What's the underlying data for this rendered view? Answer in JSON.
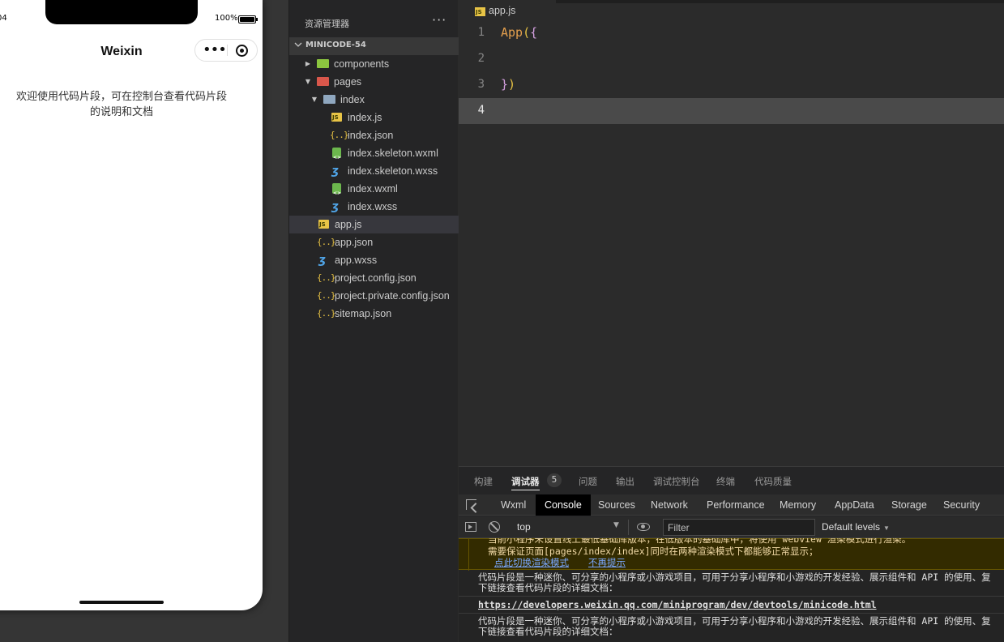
{
  "simulator": {
    "status_time": "04",
    "battery_text": "100%",
    "nav_title": "Weixin",
    "welcome_line1": "欢迎使用代码片段，可在控制台查看代码片段",
    "welcome_line2": "的说明和文档",
    "capsule_more_icon": "ellipsis-icon",
    "capsule_close_icon": "target-icon"
  },
  "explorer": {
    "title": "资源管理器",
    "more": "···",
    "project": "MINICODE-54",
    "items": [
      {
        "label": "components",
        "icon": "folder-green"
      },
      {
        "label": "pages",
        "icon": "folder-red"
      },
      {
        "label": "index",
        "icon": "folder-open"
      },
      {
        "label": "index.js",
        "icon": "js"
      },
      {
        "label": "index.json",
        "icon": "json"
      },
      {
        "label": "index.skeleton.wxml",
        "icon": "wxml"
      },
      {
        "label": "index.skeleton.wxss",
        "icon": "wxss"
      },
      {
        "label": "index.wxml",
        "icon": "wxml"
      },
      {
        "label": "index.wxss",
        "icon": "wxss"
      },
      {
        "label": "app.js",
        "icon": "js"
      },
      {
        "label": "app.json",
        "icon": "json"
      },
      {
        "label": "app.wxss",
        "icon": "wxss"
      },
      {
        "label": "project.config.json",
        "icon": "json"
      },
      {
        "label": "project.private.config.json",
        "icon": "json"
      },
      {
        "label": "sitemap.json",
        "icon": "json"
      }
    ]
  },
  "editor": {
    "breadcrumb": "app.js",
    "line_numbers": [
      "1",
      "2",
      "3",
      "4"
    ],
    "code": {
      "fn": "App",
      "open_paren": "(",
      "open_brace": "{",
      "close_brace": "}",
      "close_paren": ")"
    }
  },
  "panel": {
    "tabs": [
      "构建",
      "调试器",
      "问题",
      "输出",
      "调试控制台",
      "终端",
      "代码质量"
    ],
    "debugger_badge": "5",
    "devtools_tabs": [
      "Wxml",
      "Console",
      "Sources",
      "Network",
      "Performance",
      "Memory",
      "AppData",
      "Storage",
      "Security"
    ],
    "context": "top",
    "filter_placeholder": "Filter",
    "levels": "Default levels",
    "warning": {
      "line1": "当前小程序未设置线上最低基础库版本，在低版本的基础库中，将使用 webview 渲染模式进行渲染。",
      "line2": "需要保证页面[pages/index/index]同时在两种渲染模式下都能够正常显示；",
      "link1": "点此切换渲染模式",
      "link2": "不再提示"
    },
    "logs": [
      {
        "line1": "代码片段是一种迷你、可分享的小程序或小游戏项目，可用于分享小程序和小游戏的开发经验、展示组件和 API 的使用、复",
        "line2": "下链接查看代码片段的详细文档："
      },
      {
        "link": "https://developers.weixin.qq.com/miniprogram/dev/devtools/minicode.html"
      },
      {
        "line1": "代码片段是一种迷你、可分享的小程序或小游戏项目，可用于分享小程序和小游戏的开发经验、展示组件和 API 的使用、复",
        "line2": "下链接查看代码片段的详细文档："
      }
    ]
  }
}
